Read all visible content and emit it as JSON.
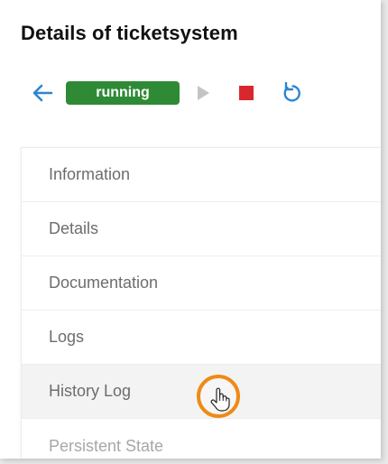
{
  "header": {
    "title": "Details of ticketsystem"
  },
  "toolbar": {
    "back_icon": "arrow-left-icon",
    "status": "running",
    "status_color": "#2f8a36",
    "play_icon": "play-icon",
    "play_color": "#c4c4c4",
    "stop_icon": "stop-icon",
    "stop_color": "#d9272e",
    "restart_icon": "restart-icon",
    "accent_color": "#2b86d3"
  },
  "menu": {
    "items": [
      {
        "label": "Information"
      },
      {
        "label": "Details"
      },
      {
        "label": "Documentation"
      },
      {
        "label": "Logs"
      },
      {
        "label": "History Log"
      },
      {
        "label": "Persistent State"
      }
    ],
    "hovered_item": "History Log"
  },
  "cursor": {
    "icon": "hand-pointer-icon",
    "highlight_color": "#ef8a16"
  }
}
